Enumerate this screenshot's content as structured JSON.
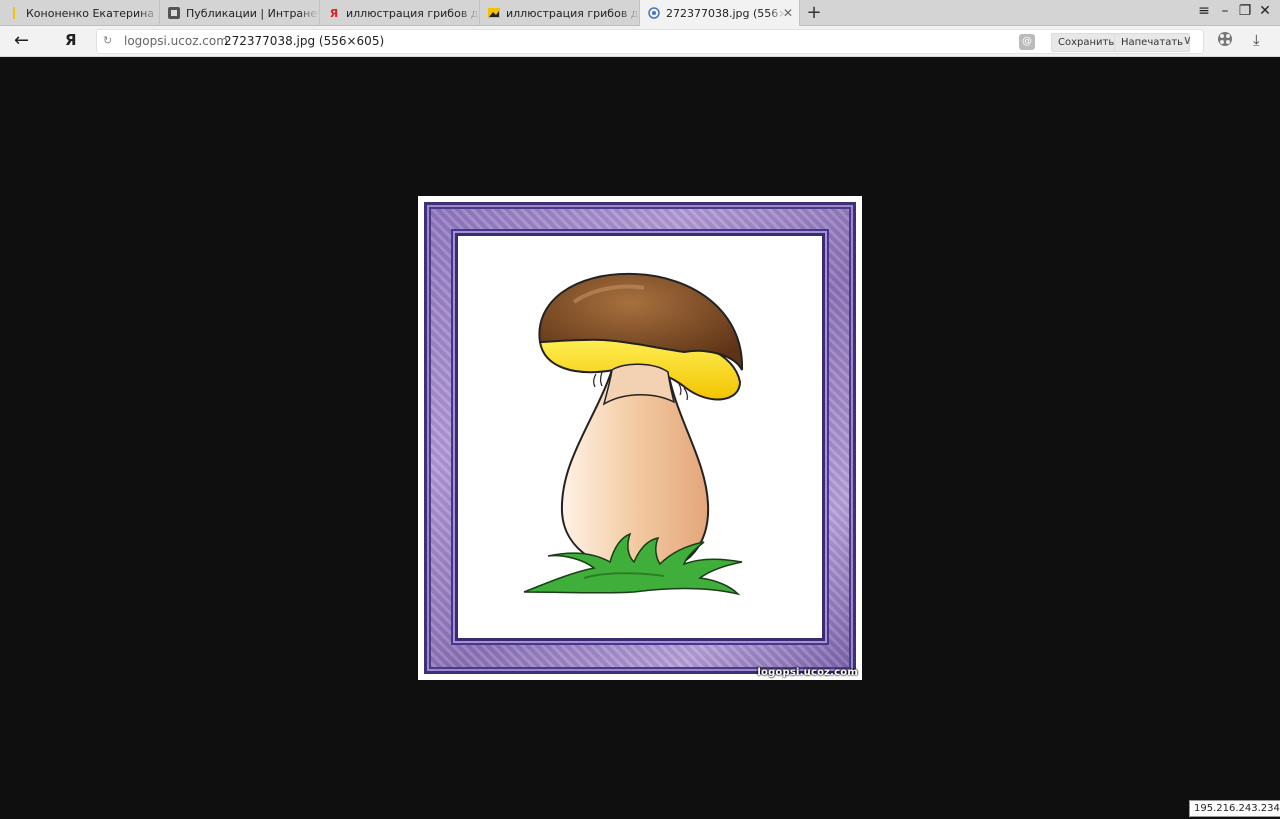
{
  "tabs": [
    {
      "label": "Кононенко Екатерина Алек",
      "icon": "person-icon"
    },
    {
      "label": "Публикации | Интранет-по",
      "icon": "portal-icon"
    },
    {
      "label": "иллюстрация грибов для д",
      "icon": "yandex-icon"
    },
    {
      "label": "иллюстрация грибов для д",
      "icon": "image-icon"
    },
    {
      "label": "272377038.jpg (556×605",
      "icon": "shield-icon",
      "active": true
    }
  ],
  "toolbar": {
    "domain": "logopsi.ucoz.com",
    "path": "272377038.jpg (556×605)",
    "save_label": "Сохранить",
    "print_label": "Напечатать"
  },
  "image": {
    "watermark": "logopsi.ucoz.com"
  },
  "status": {
    "ip": "195.216.243.234"
  },
  "colors": {
    "frame": "#8f76bf",
    "cap": "#7a4a28",
    "cap_underside": "#ffe11a",
    "stem": "#f2c9a3",
    "grass": "#3fae3a"
  }
}
